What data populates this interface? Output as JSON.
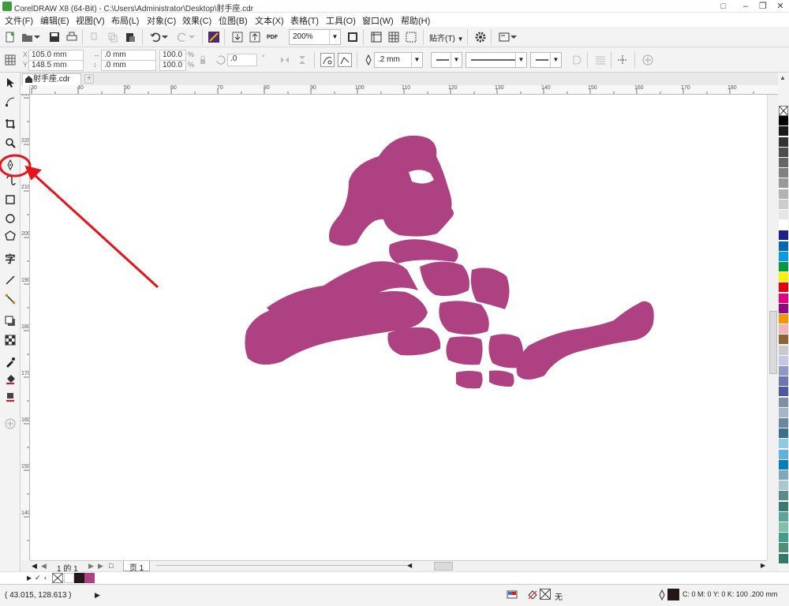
{
  "window": {
    "title": "CorelDRAW X8 (64-Bit) - C:\\Users\\Administrator\\Desktop\\射手座.cdr"
  },
  "menu": [
    "文件(F)",
    "编辑(E)",
    "视图(V)",
    "布局(L)",
    "对象(C)",
    "效果(C)",
    "位图(B)",
    "文本(X)",
    "表格(T)",
    "工具(O)",
    "窗口(W)",
    "帮助(H)"
  ],
  "toolbar": {
    "zoom": "200%",
    "snap_label": "贴齐(T)",
    "pdf_label": "PDF"
  },
  "propbar": {
    "x": "105.0 mm",
    "y": "148.5 mm",
    "w": ".0 mm",
    "h": ".0 mm",
    "scale_x": "100.0",
    "scale_y": "100.0",
    "pct": "%",
    "angle": ".0",
    "outline_width": ".2 mm"
  },
  "document": {
    "tab_label": "射手座.cdr",
    "page_counter": "1 的 1",
    "page_tab": "页 1"
  },
  "ruler_h": [
    "30",
    "40",
    "50",
    "60",
    "70",
    "80",
    "90",
    "100",
    "110",
    "120",
    "130",
    "140",
    "150",
    "160",
    "170",
    "180"
  ],
  "ruler_v": [
    "230",
    "220",
    "210",
    "200",
    "190",
    "180",
    "170",
    "160",
    "150",
    "140",
    "130",
    "120"
  ],
  "status": {
    "coords": "( 43.015, 128.613 )",
    "fill_none": "无",
    "outline_info": "C: 0 M: 0 Y: 0 K: 100  .200 mm"
  },
  "colors": {
    "shape": "#ae4181",
    "annotation": "#e8131a"
  },
  "palette": [
    "#ffffff",
    "#000000",
    "#1a1a1a",
    "#333333",
    "#4d4d4d",
    "#666666",
    "#808080",
    "#999999",
    "#b3b3b3",
    "#cccccc",
    "#e6e6e6",
    "#ffffff",
    "#1d2088",
    "#0068b7",
    "#00a0e9",
    "#009944",
    "#fff100",
    "#e60012",
    "#e4007f",
    "#920783",
    "#f39800",
    "#f5b2b2",
    "#8c6239",
    "#c9caca",
    "#c4c8e6",
    "#8f98c9",
    "#6a76b6",
    "#4b5aa0",
    "#7f8fa6",
    "#a2b8c9",
    "#6a87a2",
    "#3c6e8f",
    "#8dc9e8",
    "#5fb3dc",
    "#0080c0",
    "#7fa7b5",
    "#a7c8d2",
    "#5c8a8a",
    "#3b7a6e",
    "#5aa69a",
    "#7fbfa8",
    "#3fa08a",
    "#4f8f7a",
    "#2f7a6a"
  ]
}
